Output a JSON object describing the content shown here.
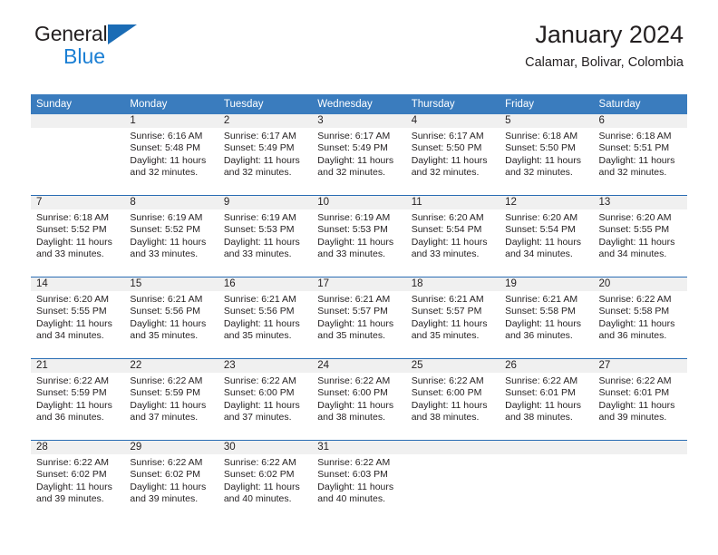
{
  "brand": {
    "name_top": "General",
    "name_bottom": "Blue",
    "triangle_color": "#1b6cb5",
    "blue_color": "#1b7fd4"
  },
  "header": {
    "title": "January 2024",
    "subtitle": "Calamar, Bolivar, Colombia"
  },
  "theme": {
    "header_row_bg": "#3a7cbe",
    "daynum_strip_bg": "#f0f0f0",
    "row_divider": "#2a6db4",
    "text": "#231f20"
  },
  "calendar": {
    "weekday_headers": [
      "Sunday",
      "Monday",
      "Tuesday",
      "Wednesday",
      "Thursday",
      "Friday",
      "Saturday"
    ],
    "weeks": [
      [
        {
          "day": "",
          "empty": true,
          "lines": []
        },
        {
          "day": "1",
          "lines": [
            "Sunrise: 6:16 AM",
            "Sunset: 5:48 PM",
            "Daylight: 11 hours",
            "and 32 minutes."
          ]
        },
        {
          "day": "2",
          "lines": [
            "Sunrise: 6:17 AM",
            "Sunset: 5:49 PM",
            "Daylight: 11 hours",
            "and 32 minutes."
          ]
        },
        {
          "day": "3",
          "lines": [
            "Sunrise: 6:17 AM",
            "Sunset: 5:49 PM",
            "Daylight: 11 hours",
            "and 32 minutes."
          ]
        },
        {
          "day": "4",
          "lines": [
            "Sunrise: 6:17 AM",
            "Sunset: 5:50 PM",
            "Daylight: 11 hours",
            "and 32 minutes."
          ]
        },
        {
          "day": "5",
          "lines": [
            "Sunrise: 6:18 AM",
            "Sunset: 5:50 PM",
            "Daylight: 11 hours",
            "and 32 minutes."
          ]
        },
        {
          "day": "6",
          "lines": [
            "Sunrise: 6:18 AM",
            "Sunset: 5:51 PM",
            "Daylight: 11 hours",
            "and 32 minutes."
          ]
        }
      ],
      [
        {
          "day": "7",
          "lines": [
            "Sunrise: 6:18 AM",
            "Sunset: 5:52 PM",
            "Daylight: 11 hours",
            "and 33 minutes."
          ]
        },
        {
          "day": "8",
          "lines": [
            "Sunrise: 6:19 AM",
            "Sunset: 5:52 PM",
            "Daylight: 11 hours",
            "and 33 minutes."
          ]
        },
        {
          "day": "9",
          "lines": [
            "Sunrise: 6:19 AM",
            "Sunset: 5:53 PM",
            "Daylight: 11 hours",
            "and 33 minutes."
          ]
        },
        {
          "day": "10",
          "lines": [
            "Sunrise: 6:19 AM",
            "Sunset: 5:53 PM",
            "Daylight: 11 hours",
            "and 33 minutes."
          ]
        },
        {
          "day": "11",
          "lines": [
            "Sunrise: 6:20 AM",
            "Sunset: 5:54 PM",
            "Daylight: 11 hours",
            "and 33 minutes."
          ]
        },
        {
          "day": "12",
          "lines": [
            "Sunrise: 6:20 AM",
            "Sunset: 5:54 PM",
            "Daylight: 11 hours",
            "and 34 minutes."
          ]
        },
        {
          "day": "13",
          "lines": [
            "Sunrise: 6:20 AM",
            "Sunset: 5:55 PM",
            "Daylight: 11 hours",
            "and 34 minutes."
          ]
        }
      ],
      [
        {
          "day": "14",
          "lines": [
            "Sunrise: 6:20 AM",
            "Sunset: 5:55 PM",
            "Daylight: 11 hours",
            "and 34 minutes."
          ]
        },
        {
          "day": "15",
          "lines": [
            "Sunrise: 6:21 AM",
            "Sunset: 5:56 PM",
            "Daylight: 11 hours",
            "and 35 minutes."
          ]
        },
        {
          "day": "16",
          "lines": [
            "Sunrise: 6:21 AM",
            "Sunset: 5:56 PM",
            "Daylight: 11 hours",
            "and 35 minutes."
          ]
        },
        {
          "day": "17",
          "lines": [
            "Sunrise: 6:21 AM",
            "Sunset: 5:57 PM",
            "Daylight: 11 hours",
            "and 35 minutes."
          ]
        },
        {
          "day": "18",
          "lines": [
            "Sunrise: 6:21 AM",
            "Sunset: 5:57 PM",
            "Daylight: 11 hours",
            "and 35 minutes."
          ]
        },
        {
          "day": "19",
          "lines": [
            "Sunrise: 6:21 AM",
            "Sunset: 5:58 PM",
            "Daylight: 11 hours",
            "and 36 minutes."
          ]
        },
        {
          "day": "20",
          "lines": [
            "Sunrise: 6:22 AM",
            "Sunset: 5:58 PM",
            "Daylight: 11 hours",
            "and 36 minutes."
          ]
        }
      ],
      [
        {
          "day": "21",
          "lines": [
            "Sunrise: 6:22 AM",
            "Sunset: 5:59 PM",
            "Daylight: 11 hours",
            "and 36 minutes."
          ]
        },
        {
          "day": "22",
          "lines": [
            "Sunrise: 6:22 AM",
            "Sunset: 5:59 PM",
            "Daylight: 11 hours",
            "and 37 minutes."
          ]
        },
        {
          "day": "23",
          "lines": [
            "Sunrise: 6:22 AM",
            "Sunset: 6:00 PM",
            "Daylight: 11 hours",
            "and 37 minutes."
          ]
        },
        {
          "day": "24",
          "lines": [
            "Sunrise: 6:22 AM",
            "Sunset: 6:00 PM",
            "Daylight: 11 hours",
            "and 38 minutes."
          ]
        },
        {
          "day": "25",
          "lines": [
            "Sunrise: 6:22 AM",
            "Sunset: 6:00 PM",
            "Daylight: 11 hours",
            "and 38 minutes."
          ]
        },
        {
          "day": "26",
          "lines": [
            "Sunrise: 6:22 AM",
            "Sunset: 6:01 PM",
            "Daylight: 11 hours",
            "and 38 minutes."
          ]
        },
        {
          "day": "27",
          "lines": [
            "Sunrise: 6:22 AM",
            "Sunset: 6:01 PM",
            "Daylight: 11 hours",
            "and 39 minutes."
          ]
        }
      ],
      [
        {
          "day": "28",
          "lines": [
            "Sunrise: 6:22 AM",
            "Sunset: 6:02 PM",
            "Daylight: 11 hours",
            "and 39 minutes."
          ]
        },
        {
          "day": "29",
          "lines": [
            "Sunrise: 6:22 AM",
            "Sunset: 6:02 PM",
            "Daylight: 11 hours",
            "and 39 minutes."
          ]
        },
        {
          "day": "30",
          "lines": [
            "Sunrise: 6:22 AM",
            "Sunset: 6:02 PM",
            "Daylight: 11 hours",
            "and 40 minutes."
          ]
        },
        {
          "day": "31",
          "lines": [
            "Sunrise: 6:22 AM",
            "Sunset: 6:03 PM",
            "Daylight: 11 hours",
            "and 40 minutes."
          ]
        },
        {
          "day": "",
          "empty": true,
          "lines": []
        },
        {
          "day": "",
          "empty": true,
          "lines": []
        },
        {
          "day": "",
          "empty": true,
          "lines": []
        }
      ]
    ]
  }
}
